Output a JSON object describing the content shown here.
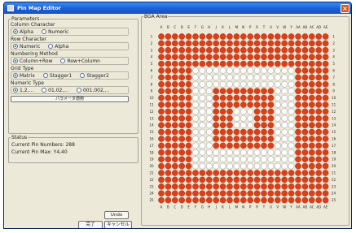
{
  "window": {
    "title": "Pin Map Editor",
    "close_icon": "close-icon",
    "app_icon": "app-icon"
  },
  "params": {
    "title": "Parameters",
    "column_char": {
      "title": "Column Character",
      "options": [
        "Alpha",
        "Numeric"
      ],
      "selected": 0
    },
    "row_char": {
      "title": "Row Character",
      "options": [
        "Numeric",
        "Alpha"
      ],
      "selected": 0
    },
    "numbering": {
      "title": "Numbering Method",
      "options": [
        "Column+Row",
        "Row+Column"
      ],
      "selected": 0
    },
    "grid_type": {
      "title": "Grid Type",
      "options": [
        "Matrix",
        "Stagger1",
        "Stagger2"
      ],
      "selected": 0
    },
    "numeric_type": {
      "title": "Numeric Type",
      "options": [
        "1,2,...",
        "01,02,...",
        "001,002,..."
      ],
      "selected": 0
    },
    "apply_label": "パラメータ適用"
  },
  "status": {
    "title": "Status",
    "pin_numbers_label": "Current Pin Numbers",
    "pin_numbers_value": "288",
    "pin_max_label": "Current Pin Max",
    "pin_max_value": "Y4,40"
  },
  "buttons": {
    "undo": "Undo",
    "ok": "完了",
    "cancel": "キャンセル"
  },
  "grid": {
    "title": "BGA Area",
    "columns": [
      "A",
      "B",
      "C",
      "D",
      "E",
      "F",
      "G",
      "H",
      "J",
      "K",
      "L",
      "M",
      "N",
      "P",
      "R",
      "T",
      "U",
      "V",
      "W",
      "Y",
      "AA",
      "AB",
      "AC",
      "AD",
      "AE"
    ],
    "rows": [
      "1",
      "2",
      "3",
      "4",
      "5",
      "6",
      "7",
      "8",
      "9",
      "10",
      "11",
      "12",
      "13",
      "14",
      "15",
      "16",
      "17",
      "18",
      "19",
      "20",
      "21",
      "22",
      "23",
      "24",
      "25"
    ],
    "colors": {
      "filled": "#d8401c",
      "empty": "#ffffff",
      "outline": "#9a9a9a"
    },
    "pattern": "outer rings 1-5 filled, rings 6-8 empty, inner 9x9 block filled with empty center ring"
  }
}
